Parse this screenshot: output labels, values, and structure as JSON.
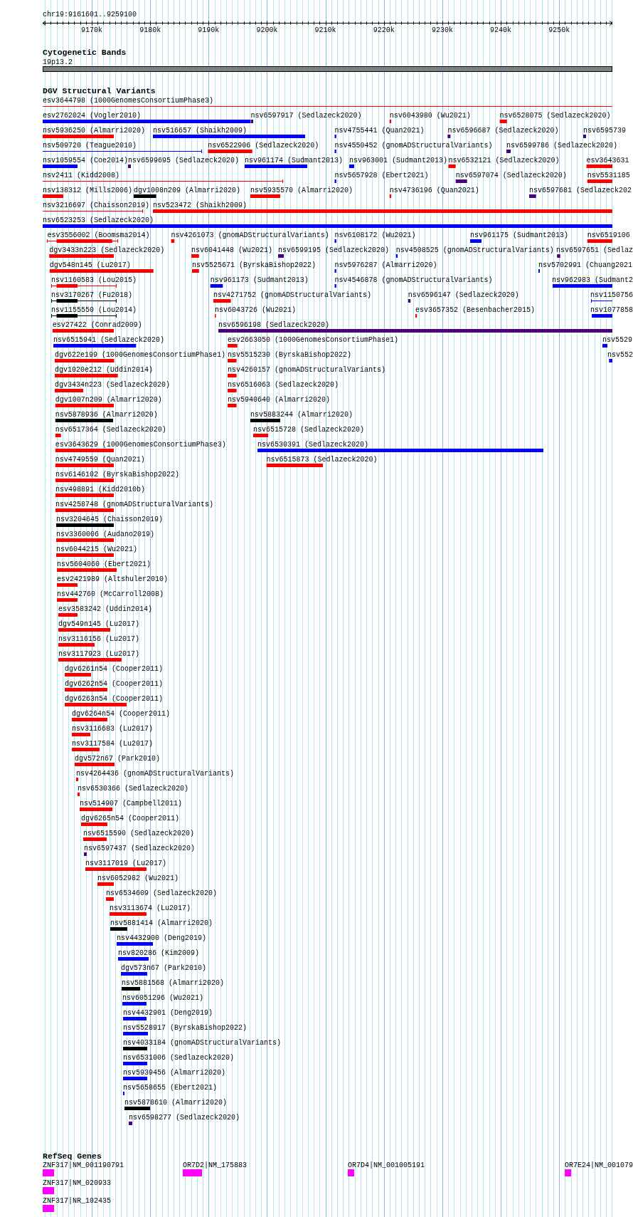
{
  "location": "chr19:9161601..9259100",
  "ruler": {
    "ticks": [
      "9170k",
      "9180k",
      "9190k",
      "9200k",
      "9210k",
      "9220k",
      "9230k",
      "9240k",
      "9250k"
    ]
  },
  "tracks": [
    {
      "kind": "bands",
      "title": "Cytogenetic Bands",
      "rows": [
        [
          {
            "label": "19p13.2"
          }
        ]
      ]
    },
    {
      "kind": "variants",
      "title": "DGV Structural Variants",
      "rows": [
        [
          {
            "label": "esv3644798 (1000GenomesConsortiumPhase3)",
            "color": "#ff0000",
            "kind": "line"
          }
        ],
        [
          {
            "label": "esv2762024 (Vogler2010)",
            "color": "#0000ff",
            "kind": "bar"
          },
          {
            "label": "nsv6597917 (Sedlazeck2020)",
            "color": "#4b0082",
            "kind": "bar"
          },
          {
            "label": "nsv6043980 (Wu2021)",
            "color": "#ff0000",
            "kind": "bar"
          },
          {
            "label": "nsv6528075 (Sedlazeck2020)",
            "color": "#ff0000",
            "kind": "bar"
          }
        ],
        [
          {
            "label": "nsv5936250 (Almarri2020)",
            "color": "#ff0000",
            "kind": "bar"
          },
          {
            "label": "nsv516657 (Shaikh2009)",
            "color": "#0000ff",
            "kind": "bar"
          },
          {
            "label": "nsv4755441 (Quan2021)",
            "color": "#0000ff",
            "kind": "bar"
          },
          {
            "label": "nsv6596687 (Sedlazeck2020)",
            "color": "#4b0082",
            "kind": "bar"
          },
          {
            "label": "nsv6595739",
            "color": "#4b0082",
            "kind": "bar"
          }
        ],
        [
          {
            "label": "nsv509720 (Teague2010)",
            "color": "#0000ff",
            "kind": "line"
          },
          {
            "label": "nsv6522906 (Sedlazeck2020)",
            "color": "#ff0000",
            "kind": "bar"
          },
          {
            "label": "nsv4550452 (gnomADStructuralVariants)",
            "color": "#0000ff",
            "kind": "bar"
          },
          {
            "label": "nsv6599786 (Sedlazeck2020)",
            "color": "#4b0082",
            "kind": "bar"
          }
        ],
        [
          {
            "label": "nsv1059554 (Coe2014)",
            "color": "#0000ff",
            "kind": "bar"
          },
          {
            "label": "nsv6599695 (Sedlazeck2020)",
            "color": "#4b0082",
            "kind": "bar"
          },
          {
            "label": "nsv961174 (Sudmant2013)",
            "color": "#0000ff",
            "kind": "bar"
          },
          {
            "label": "nsv963001 (Sudmant2013)",
            "color": "#0000ff",
            "kind": "bar"
          },
          {
            "label": "nsv6532121 (Sedlazeck2020)",
            "color": "#ff0000",
            "kind": "bar"
          },
          {
            "label": "esv3643631",
            "color": "#ff0000",
            "kind": "bar"
          }
        ],
        [
          {
            "label": "nsv2411 (Kidd2008)",
            "color": "#ff0000",
            "kind": "line"
          },
          {
            "label": "nsv5657928 (Ebert2021)",
            "color": "#0000ff",
            "kind": "bar"
          },
          {
            "label": "nsv6597074 (Sedlazeck2020)",
            "color": "#4b0082",
            "kind": "bar"
          },
          {
            "label": "nsv5531185",
            "color": "#ff0000",
            "kind": "bar"
          }
        ],
        [
          {
            "label": "nsv138312 (Mills2006)",
            "color": "#ff0000",
            "kind": "bar"
          },
          {
            "label": "dgv1008n209 (Almarri2020)",
            "color": "#000000",
            "kind": "bar"
          },
          {
            "label": "nsv5935570 (Almarri2020)",
            "color": "#ff0000",
            "kind": "bar"
          },
          {
            "label": "nsv4736196 (Quan2021)",
            "color": "#ff0000",
            "kind": "bar"
          },
          {
            "label": "nsv6597681 (Sedlazeck202",
            "color": "#4b0082",
            "kind": "bar"
          }
        ],
        [
          {
            "label": "nsv3216697 (Chaisson2019)",
            "color": "#ff0000",
            "kind": "line"
          },
          {
            "label": "nsv523472 (Shaikh2009)",
            "color": "#ff0000",
            "kind": "bar"
          }
        ],
        [
          {
            "label": "nsv6523253 (Sedlazeck2020)",
            "color": "#0000ff",
            "kind": "bar"
          }
        ],
        [
          {
            "label": "esv3556002 (Boomsma2014)",
            "color": "#ff0000",
            "kind": "whisker"
          },
          {
            "label": "nsv4261073 (gnomADStructuralVariants)",
            "color": "#ff0000",
            "kind": "bar"
          },
          {
            "label": "nsv6108172 (Wu2021)",
            "color": "#0000ff",
            "kind": "bar"
          },
          {
            "label": "nsv961175 (Sudmant2013)",
            "color": "#0000ff",
            "kind": "bar"
          },
          {
            "label": "nsv6519106",
            "color": "#ff0000",
            "kind": "bar"
          }
        ],
        [
          {
            "label": "dgv3433n223 (Sedlazeck2020)",
            "color": "#ff0000",
            "kind": "bar"
          },
          {
            "label": "nsv6041448 (Wu2021)",
            "color": "#ff0000",
            "kind": "bar"
          },
          {
            "label": "nsv6599195 (Sedlazeck2020)",
            "color": "#4b0082",
            "kind": "bar"
          },
          {
            "label": "nsv4508525 (gnomADStructuralVariants)",
            "color": "#0000ff",
            "kind": "bar"
          },
          {
            "label": "nsv6597651 (Sedlaz",
            "color": "#4b0082",
            "kind": "bar"
          }
        ],
        [
          {
            "label": "dgv548n145 (Lu2017)",
            "color": "#ff0000",
            "kind": "bar"
          },
          {
            "label": "nsv5525671 (ByrskaBishop2022)",
            "color": "#ff0000",
            "kind": "bar"
          },
          {
            "label": "nsv5976287 (Almarri2020)",
            "color": "#0000ff",
            "kind": "bar"
          },
          {
            "label": "nsv5702991 (Chuang2021",
            "color": "#0000ff",
            "kind": "bar"
          }
        ],
        [
          {
            "label": "nsv1160583 (Lou2015)",
            "color": "#ff0000",
            "kind": "whisker"
          },
          {
            "label": "nsv961173 (Sudmant2013)",
            "color": "#0000ff",
            "kind": "bar"
          },
          {
            "label": "nsv4546878 (gnomADStructuralVariants)",
            "color": "#0000ff",
            "kind": "bar"
          },
          {
            "label": "nsv962983 (Sudmant2",
            "color": "#0000ff",
            "kind": "bar"
          }
        ],
        [
          {
            "label": "nsv3170267 (Fu2018)",
            "color": "#000000",
            "kind": "whisker"
          },
          {
            "label": "nsv4271752 (gnomADStructuralVariants)",
            "color": "#ff0000",
            "kind": "bar"
          },
          {
            "label": "nsv6596147 (Sedlazeck2020)",
            "color": "#4b0082",
            "kind": "bar"
          },
          {
            "label": "nsv1150756",
            "color": "#0000ff",
            "kind": "line"
          }
        ],
        [
          {
            "label": "nsv1155550 (Lou2014)",
            "color": "#000000",
            "kind": "whisker"
          },
          {
            "label": "nsv6043726 (Wu2021)",
            "color": "#ff0000",
            "kind": "bar"
          },
          {
            "label": "esv3657352 (Besenbacher2015)",
            "color": "#ff0000",
            "kind": "bar"
          },
          {
            "label": "nsv1077858",
            "color": "#0000ff",
            "kind": "bar"
          }
        ],
        [
          {
            "label": "esv27422 (Conrad2009)",
            "color": "#ff0000",
            "kind": "bar"
          },
          {
            "label": "nsv6596198 (Sedlazeck2020)",
            "color": "#4b0082",
            "kind": "bar"
          }
        ],
        [
          {
            "label": "nsv6515941 (Sedlazeck2020)",
            "color": "#0000ff",
            "kind": "bar"
          },
          {
            "label": "esv2663050 (1000GenomesConsortiumPhase1)",
            "color": "#ff0000",
            "kind": "bar"
          },
          {
            "label": "nsv5529",
            "color": "#0000ff",
            "kind": "bar"
          }
        ],
        [
          {
            "label": "dgv622e199 (1000GenomesConsortiumPhase1)",
            "color": "#ff0000",
            "kind": "bar"
          },
          {
            "label": "nsv5515230 (ByrskaBishop2022)",
            "color": "#ff0000",
            "kind": "bar"
          },
          {
            "label": "nsv552",
            "color": "#0000ff",
            "kind": "bar"
          }
        ],
        [
          {
            "label": "dgv1020e212 (Uddin2014)",
            "color": "#ff0000",
            "kind": "bar"
          },
          {
            "label": "nsv4260157 (gnomADStructuralVariants)",
            "color": "#ff0000",
            "kind": "bar"
          }
        ],
        [
          {
            "label": "dgv3434n223 (Sedlazeck2020)",
            "color": "#ff0000",
            "kind": "bar"
          },
          {
            "label": "nsv6516063 (Sedlazeck2020)",
            "color": "#ff0000",
            "kind": "bar"
          }
        ],
        [
          {
            "label": "dgv1007n209 (Almarri2020)",
            "color": "#ff0000",
            "kind": "bar"
          },
          {
            "label": "nsv5940640 (Almarri2020)",
            "color": "#ff0000",
            "kind": "bar"
          }
        ],
        [
          {
            "label": "nsv5878936 (Almarri2020)",
            "color": "#000000",
            "kind": "bar"
          },
          {
            "label": "nsv5883244 (Almarri2020)",
            "color": "#000000",
            "kind": "bar"
          }
        ],
        [
          {
            "label": "nsv6517364 (Sedlazeck2020)",
            "color": "#ff0000",
            "kind": "bar"
          },
          {
            "label": "nsv6515728 (Sedlazeck2020)",
            "color": "#ff0000",
            "kind": "bar"
          }
        ],
        [
          {
            "label": "esv3643629 (1000GenomesConsortiumPhase3)",
            "color": "#ff0000",
            "kind": "bar"
          },
          {
            "label": "nsv6530391 (Sedlazeck2020)",
            "color": "#0000ff",
            "kind": "bar"
          }
        ],
        [
          {
            "label": "nsv4749559 (Quan2021)",
            "color": "#ff0000",
            "kind": "bar"
          },
          {
            "label": "nsv6515873 (Sedlazeck2020)",
            "color": "#ff0000",
            "kind": "bar"
          }
        ],
        [
          {
            "label": "nsv6146102 (ByrskaBishop2022)",
            "color": "#ff0000",
            "kind": "bar"
          }
        ],
        [
          {
            "label": "nsv498891 (Kidd2010b)",
            "color": "#ff0000",
            "kind": "bar"
          }
        ],
        [
          {
            "label": "nsv4258748 (gnomADStructuralVariants)",
            "color": "#ff0000",
            "kind": "bar"
          }
        ],
        [
          {
            "label": "nsv3204645 (Chaisson2019)",
            "color": "#000000",
            "kind": "bar"
          }
        ],
        [
          {
            "label": "nsv3360006 (Audano2019)",
            "color": "#ff0000",
            "kind": "bar"
          }
        ],
        [
          {
            "label": "nsv6044215 (Wu2021)",
            "color": "#ff0000",
            "kind": "bar"
          }
        ],
        [
          {
            "label": "nsv5604060 (Ebert2021)",
            "color": "#ff0000",
            "kind": "bar"
          }
        ],
        [
          {
            "label": "esv2421989 (Altshuler2010)",
            "color": "#ff0000",
            "kind": "bar"
          }
        ],
        [
          {
            "label": "nsv442760 (McCarroll2008)",
            "color": "#ff0000",
            "kind": "bar"
          }
        ],
        [
          {
            "label": "esv3583242 (Uddin2014)",
            "color": "#ff0000",
            "kind": "bar"
          }
        ],
        [
          {
            "label": "dgv549n145 (Lu2017)",
            "color": "#ff0000",
            "kind": "bar"
          }
        ],
        [
          {
            "label": "nsv3116156 (Lu2017)",
            "color": "#ff0000",
            "kind": "bar"
          }
        ],
        [
          {
            "label": "nsv3117923 (Lu2017)",
            "color": "#ff0000",
            "kind": "bar"
          }
        ],
        [
          {
            "label": "dgv6261n54 (Cooper2011)",
            "color": "#ff0000",
            "kind": "bar"
          }
        ],
        [
          {
            "label": "dgv6262n54 (Cooper2011)",
            "color": "#ff0000",
            "kind": "bar"
          }
        ],
        [
          {
            "label": "dgv6263n54 (Cooper2011)",
            "color": "#ff0000",
            "kind": "bar"
          }
        ],
        [
          {
            "label": "dgv6264n54 (Cooper2011)",
            "color": "#ff0000",
            "kind": "bar"
          }
        ],
        [
          {
            "label": "nsv3116683 (Lu2017)",
            "color": "#ff0000",
            "kind": "bar"
          }
        ],
        [
          {
            "label": "nsv3117584 (Lu2017)",
            "color": "#ff0000",
            "kind": "bar"
          }
        ],
        [
          {
            "label": "dgv572n67 (Park2010)",
            "color": "#ff0000",
            "kind": "bar"
          }
        ],
        [
          {
            "label": "nsv4264436 (gnomADStructuralVariants)",
            "color": "#ff0000",
            "kind": "bar"
          }
        ],
        [
          {
            "label": "nsv6530366 (Sedlazeck2020)",
            "color": "#ff0000",
            "kind": "bar"
          }
        ],
        [
          {
            "label": "nsv514907 (Campbell2011)",
            "color": "#ff0000",
            "kind": "bar"
          }
        ],
        [
          {
            "label": "dgv6265n54 (Cooper2011)",
            "color": "#ff0000",
            "kind": "bar"
          }
        ],
        [
          {
            "label": "nsv6515590 (Sedlazeck2020)",
            "color": "#ff0000",
            "kind": "bar"
          }
        ],
        [
          {
            "label": "nsv6597437 (Sedlazeck2020)",
            "color": "#4b0082",
            "kind": "bar"
          }
        ],
        [
          {
            "label": "nsv3117019 (Lu2017)",
            "color": "#ff0000",
            "kind": "bar"
          }
        ],
        [
          {
            "label": "nsv6052982 (Wu2021)",
            "color": "#ff0000",
            "kind": "bar"
          }
        ],
        [
          {
            "label": "nsv6534609 (Sedlazeck2020)",
            "color": "#ff0000",
            "kind": "bar"
          }
        ],
        [
          {
            "label": "nsv3113674 (Lu2017)",
            "color": "#ff0000",
            "kind": "bar"
          }
        ],
        [
          {
            "label": "nsv5881414 (Almarri2020)",
            "color": "#000000",
            "kind": "bar"
          }
        ],
        [
          {
            "label": "nsv4432900 (Deng2019)",
            "color": "#0000ff",
            "kind": "bar"
          }
        ],
        [
          {
            "label": "nsv820286 (Kim2009)",
            "color": "#0000ff",
            "kind": "bar"
          }
        ],
        [
          {
            "label": "dgv573n67 (Park2010)",
            "color": "#0000ff",
            "kind": "bar"
          }
        ],
        [
          {
            "label": "nsv5881568 (Almarri2020)",
            "color": "#000000",
            "kind": "bar"
          }
        ],
        [
          {
            "label": "nsv6051296 (Wu2021)",
            "color": "#0000ff",
            "kind": "bar"
          }
        ],
        [
          {
            "label": "nsv4432901 (Deng2019)",
            "color": "#0000ff",
            "kind": "bar"
          }
        ],
        [
          {
            "label": "nsv5528917 (ByrskaBishop2022)",
            "color": "#0000ff",
            "kind": "bar"
          }
        ],
        [
          {
            "label": "nsv4033184 (gnomADStructuralVariants)",
            "color": "#000000",
            "kind": "bar"
          }
        ],
        [
          {
            "label": "nsv6531006 (Sedlazeck2020)",
            "color": "#0000ff",
            "kind": "bar"
          }
        ],
        [
          {
            "label": "nsv5939456 (Almarri2020)",
            "color": "#0000ff",
            "kind": "bar"
          }
        ],
        [
          {
            "label": "nsv5658655 (Ebert2021)",
            "color": "#0000ff",
            "kind": "bar"
          }
        ],
        [
          {
            "label": "nsv5878610 (Almarri2020)",
            "color": "#000000",
            "kind": "bar"
          }
        ],
        [
          {
            "label": "nsv6598277 (Sedlazeck2020)",
            "color": "#4b0082",
            "kind": "bar"
          }
        ]
      ]
    },
    {
      "kind": "genes",
      "title": "RefSeq Genes",
      "rows": [
        [
          {
            "label": "ZNF317|NM_001190791"
          },
          {
            "label": "OR7D2|NM_175883"
          },
          {
            "label": "OR7D4|NM_001005191"
          },
          {
            "label": "OR7E24|NM_001079"
          }
        ],
        [
          {
            "label": "ZNF317|NM_020933"
          }
        ],
        [
          {
            "label": "ZNF317|NR_102435"
          }
        ]
      ]
    }
  ]
}
